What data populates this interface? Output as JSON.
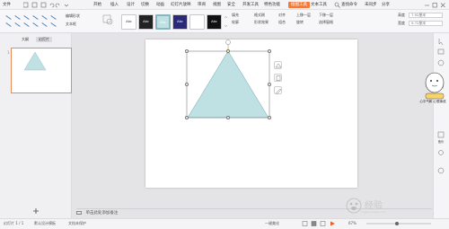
{
  "menubar": {
    "file": "文件",
    "items": [
      "开始",
      "插入",
      "设计",
      "切换",
      "动画",
      "幻灯片放映",
      "审阅",
      "视图",
      "安全",
      "开发工具",
      "特色功能"
    ],
    "active": "绘图工具",
    "text_tool": "文本工具",
    "search": "查找命令",
    "sync": "未同步",
    "share": "分享"
  },
  "ribbon": {
    "shape_fill_label": "编辑形状",
    "textbox_label": "文本框",
    "style_boxes": [
      "Abc",
      "Abc",
      "Abc",
      "Abc",
      "Abc",
      "Abc"
    ],
    "fill_label": "填充",
    "outline_label": "轮廓",
    "format_brush": "格式刷",
    "shape_effect": "形状效果",
    "align": "对齐",
    "rotate": "旋转",
    "group": "组合",
    "select_pane": "选择窗格",
    "up": "上移一层",
    "down": "下移一层",
    "height_label": "高度",
    "height_value": "7.92厘米",
    "width_label": "宽度",
    "width_value": "9.72厘米"
  },
  "sidebar": {
    "tab_outline": "大纲",
    "tab_slides": "幻灯片",
    "slide_number": "1",
    "add_icon": "plus-icon"
  },
  "notes": {
    "placeholder": "单击此处添加备注"
  },
  "rightbar": {
    "labels": [
      "",
      "",
      "",
      "形状",
      "",
      "",
      "备份",
      "",
      ""
    ]
  },
  "statusbar": {
    "slide_info": "幻灯片 1 / 1",
    "theme": "默认设计模板",
    "protect": "文档未保护",
    "beautify": "一键美化",
    "zoom": "67%"
  },
  "shape": {
    "fill": "#bfe1e4",
    "stroke": "#8ab7bd"
  },
  "accent": "#f07b3c",
  "watermark": {
    "brand": "Baidu",
    "text": "经验",
    "url": "jingyan.baidu.com"
  },
  "mascot_text": "心平气和 心想事成"
}
